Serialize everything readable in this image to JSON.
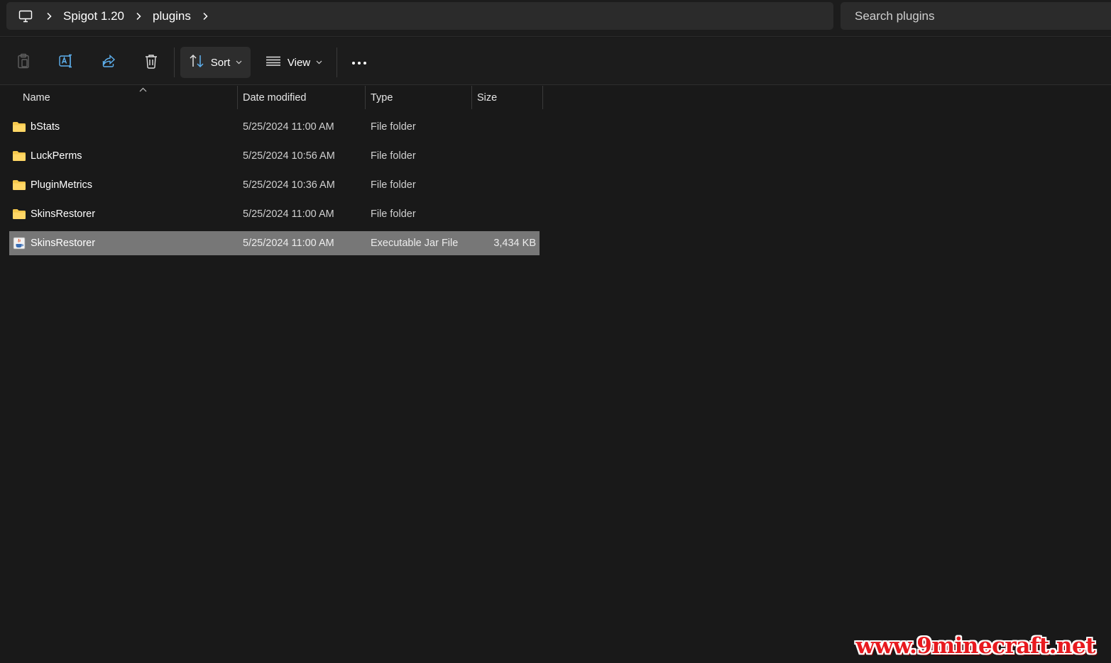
{
  "address_bar": {
    "breadcrumb": [
      {
        "label": "Spigot 1.20"
      },
      {
        "label": "plugins"
      }
    ],
    "root_icon": "computer-icon",
    "search_placeholder": "Search plugins"
  },
  "command_bar": {
    "buttons": [
      {
        "name": "paste",
        "icon": "clipboard-icon",
        "enabled": false
      },
      {
        "name": "rename",
        "icon": "rename-icon",
        "enabled": true
      },
      {
        "name": "share",
        "icon": "share-icon",
        "enabled": true
      },
      {
        "name": "delete",
        "icon": "trash-icon",
        "enabled": true
      }
    ],
    "sort_label": "Sort",
    "view_label": "View",
    "more_icon": "more-horizontal-icon"
  },
  "columns": {
    "name": "Name",
    "date": "Date modified",
    "type": "Type",
    "size": "Size",
    "sort_indicator": "chevron-up-icon"
  },
  "files": [
    {
      "name": "bStats",
      "date": "5/25/2024 11:00 AM",
      "type": "File folder",
      "size": "",
      "icon": "folder-icon",
      "selected": false
    },
    {
      "name": "LuckPerms",
      "date": "5/25/2024 10:56 AM",
      "type": "File folder",
      "size": "",
      "icon": "folder-icon",
      "selected": false
    },
    {
      "name": "PluginMetrics",
      "date": "5/25/2024 10:36 AM",
      "type": "File folder",
      "size": "",
      "icon": "folder-icon",
      "selected": false
    },
    {
      "name": "SkinsRestorer",
      "date": "5/25/2024 11:00 AM",
      "type": "File folder",
      "size": "",
      "icon": "folder-icon",
      "selected": false
    },
    {
      "name": "SkinsRestorer",
      "date": "5/25/2024 11:00 AM",
      "type": "Executable Jar File",
      "size": "3,434 KB",
      "icon": "java-jar-icon",
      "selected": true
    }
  ],
  "colors": {
    "background": "#191919",
    "folder": "#f5c84c",
    "selection": "#777777",
    "watermark": "#e8191e"
  },
  "watermark": {
    "text": "www.9minecraft.net"
  }
}
